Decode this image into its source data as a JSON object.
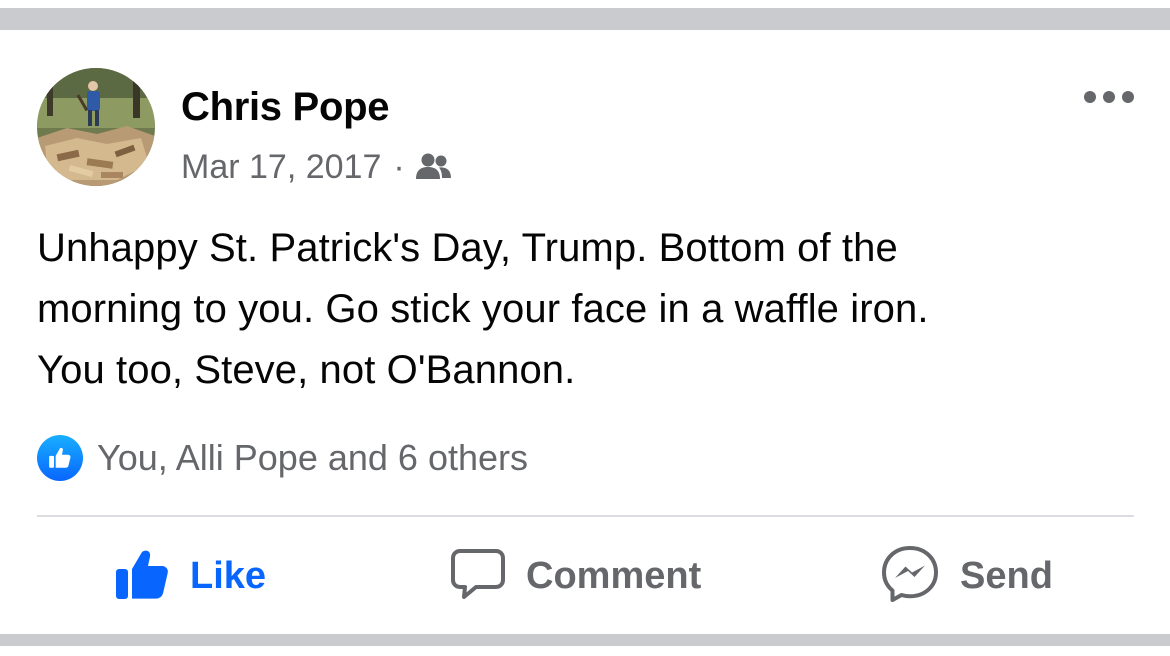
{
  "post": {
    "author": "Chris Pope",
    "date": "Mar 17, 2017",
    "separator": "·",
    "audience_icon": "friends-icon",
    "menu_icon": "more-horizontal-icon",
    "text_lines": [
      "Unhappy St. Patrick's Day, Trump. Bottom of the",
      "morning to you. Go stick your face in a waffle iron.",
      "You too, Steve, not O'Bannon."
    ]
  },
  "reactions": {
    "icon": "like-reaction-icon",
    "summary": "You, Alli Pope and 6 others"
  },
  "actions": {
    "like": {
      "label": "Like",
      "icon": "thumbs-up-icon",
      "active": true
    },
    "comment": {
      "label": "Comment",
      "icon": "comment-bubble-icon"
    },
    "send": {
      "label": "Send",
      "icon": "messenger-icon"
    }
  },
  "colors": {
    "accent": "#0866ff",
    "text_primary": "#050505",
    "text_secondary": "#65676b",
    "divider": "#dcdde1",
    "separator_band": "#cacbcf"
  }
}
